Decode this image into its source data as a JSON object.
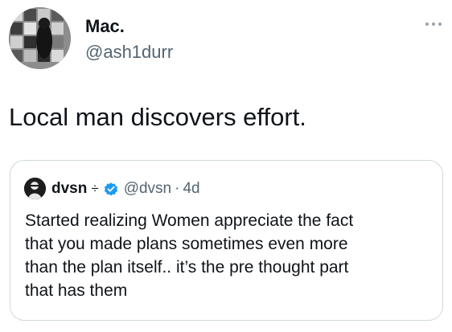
{
  "tweet": {
    "display_name": "Mac.",
    "handle": "@ash1durr",
    "text": "Local man discovers effort.",
    "avatar_icon": "profile-avatar",
    "more_icon": "more-options-icon"
  },
  "quoted_tweet": {
    "display_name": "dvsn",
    "name_badge": "÷",
    "verified_icon": "verified-badge-icon",
    "verified_color": "#1d9bf0",
    "handle": "@dvsn",
    "separator": "·",
    "timestamp": "4d",
    "text_lines": [
      "Started realizing Women appreciate the fact",
      "that you made plans sometimes even more",
      "than the plan itself.. it’s the pre thought part",
      "that has them"
    ]
  },
  "colors": {
    "text_primary": "#0f1419",
    "text_secondary": "#536471",
    "card_border": "#cfd9de",
    "background": "#ffffff"
  }
}
